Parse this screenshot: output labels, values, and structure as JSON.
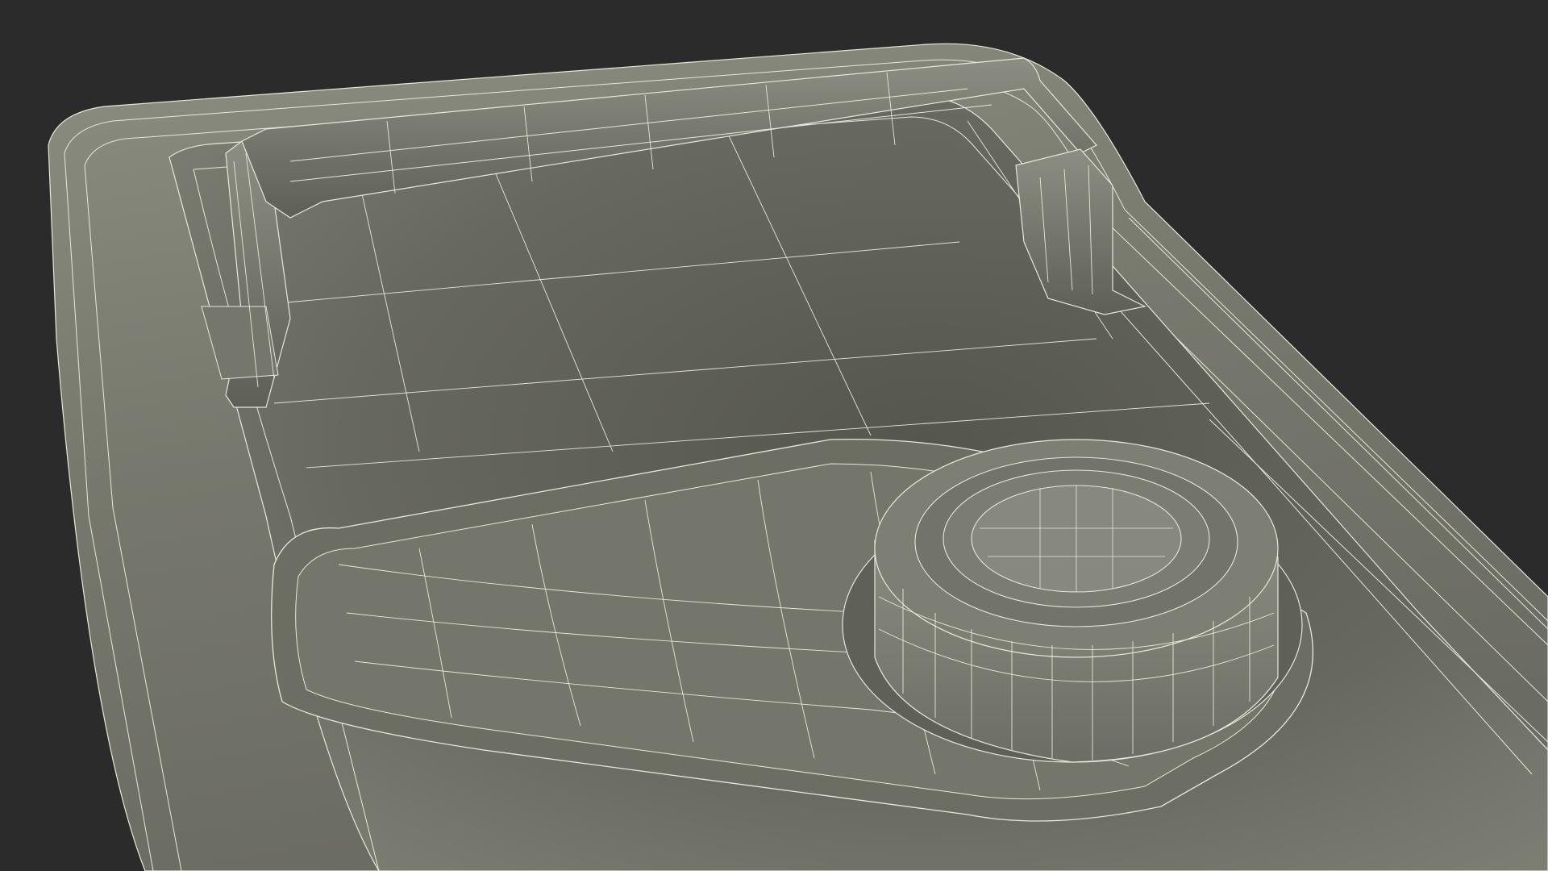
{
  "scene": {
    "subject": "wireframe-jerrycan-top",
    "colors": {
      "background": "#2b2b2b",
      "surface_light": "#8a8b7f",
      "surface_mid": "#6f7066",
      "surface_dark": "#55564e",
      "wire": "#e6e8da"
    }
  }
}
